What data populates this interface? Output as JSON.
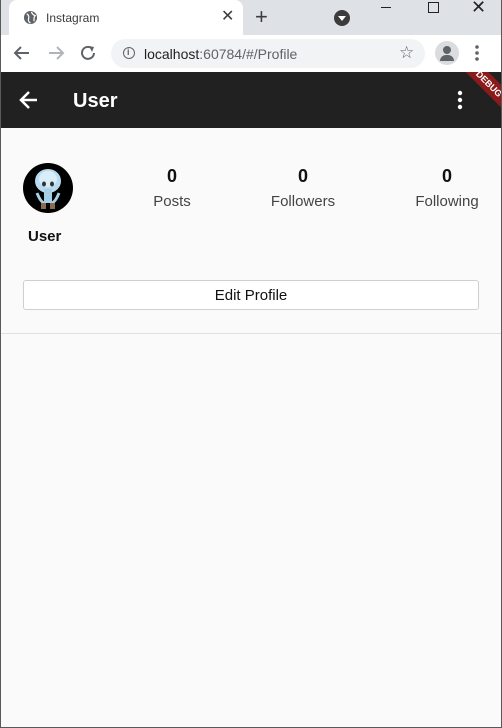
{
  "browser": {
    "tab_title": "Instagram",
    "tab_close": "✕",
    "new_tab": "+",
    "url_host": "localhost",
    "url_path": ":60784/#/Profile"
  },
  "appbar": {
    "title": "User",
    "debug_banner": "DEBUG"
  },
  "profile": {
    "username": "User",
    "stats": [
      {
        "value": "0",
        "label": "Posts"
      },
      {
        "value": "0",
        "label": "Followers"
      },
      {
        "value": "0",
        "label": "Following"
      }
    ],
    "edit_button": "Edit Profile"
  },
  "colors": {
    "appbar_bg": "#212121",
    "debug_banner": "#8b1a1a",
    "page_bg": "#fafafa"
  }
}
